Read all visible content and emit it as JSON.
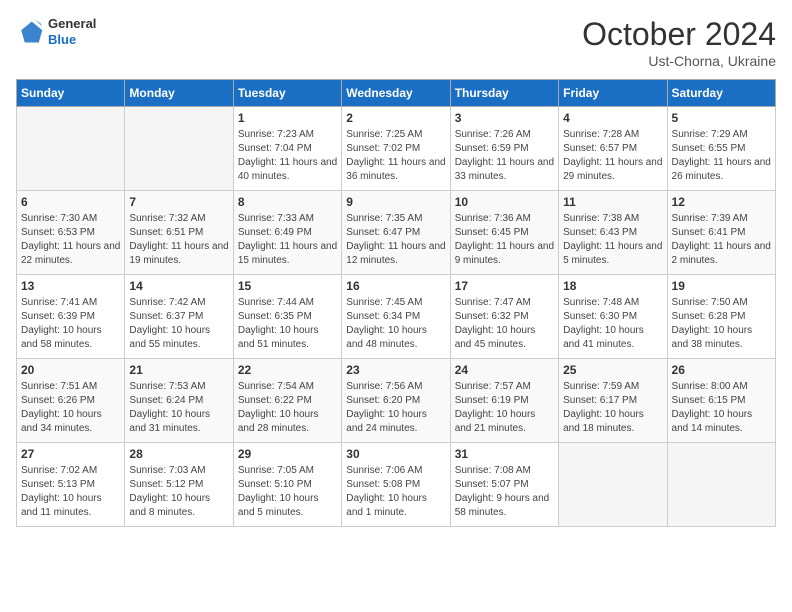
{
  "header": {
    "logo_general": "General",
    "logo_blue": "Blue",
    "month_title": "October 2024",
    "location": "Ust-Chorna, Ukraine"
  },
  "weekdays": [
    "Sunday",
    "Monday",
    "Tuesday",
    "Wednesday",
    "Thursday",
    "Friday",
    "Saturday"
  ],
  "weeks": [
    [
      {
        "day": "",
        "info": ""
      },
      {
        "day": "",
        "info": ""
      },
      {
        "day": "1",
        "info": "Sunrise: 7:23 AM\nSunset: 7:04 PM\nDaylight: 11 hours and 40 minutes."
      },
      {
        "day": "2",
        "info": "Sunrise: 7:25 AM\nSunset: 7:02 PM\nDaylight: 11 hours and 36 minutes."
      },
      {
        "day": "3",
        "info": "Sunrise: 7:26 AM\nSunset: 6:59 PM\nDaylight: 11 hours and 33 minutes."
      },
      {
        "day": "4",
        "info": "Sunrise: 7:28 AM\nSunset: 6:57 PM\nDaylight: 11 hours and 29 minutes."
      },
      {
        "day": "5",
        "info": "Sunrise: 7:29 AM\nSunset: 6:55 PM\nDaylight: 11 hours and 26 minutes."
      }
    ],
    [
      {
        "day": "6",
        "info": "Sunrise: 7:30 AM\nSunset: 6:53 PM\nDaylight: 11 hours and 22 minutes."
      },
      {
        "day": "7",
        "info": "Sunrise: 7:32 AM\nSunset: 6:51 PM\nDaylight: 11 hours and 19 minutes."
      },
      {
        "day": "8",
        "info": "Sunrise: 7:33 AM\nSunset: 6:49 PM\nDaylight: 11 hours and 15 minutes."
      },
      {
        "day": "9",
        "info": "Sunrise: 7:35 AM\nSunset: 6:47 PM\nDaylight: 11 hours and 12 minutes."
      },
      {
        "day": "10",
        "info": "Sunrise: 7:36 AM\nSunset: 6:45 PM\nDaylight: 11 hours and 9 minutes."
      },
      {
        "day": "11",
        "info": "Sunrise: 7:38 AM\nSunset: 6:43 PM\nDaylight: 11 hours and 5 minutes."
      },
      {
        "day": "12",
        "info": "Sunrise: 7:39 AM\nSunset: 6:41 PM\nDaylight: 11 hours and 2 minutes."
      }
    ],
    [
      {
        "day": "13",
        "info": "Sunrise: 7:41 AM\nSunset: 6:39 PM\nDaylight: 10 hours and 58 minutes."
      },
      {
        "day": "14",
        "info": "Sunrise: 7:42 AM\nSunset: 6:37 PM\nDaylight: 10 hours and 55 minutes."
      },
      {
        "day": "15",
        "info": "Sunrise: 7:44 AM\nSunset: 6:35 PM\nDaylight: 10 hours and 51 minutes."
      },
      {
        "day": "16",
        "info": "Sunrise: 7:45 AM\nSunset: 6:34 PM\nDaylight: 10 hours and 48 minutes."
      },
      {
        "day": "17",
        "info": "Sunrise: 7:47 AM\nSunset: 6:32 PM\nDaylight: 10 hours and 45 minutes."
      },
      {
        "day": "18",
        "info": "Sunrise: 7:48 AM\nSunset: 6:30 PM\nDaylight: 10 hours and 41 minutes."
      },
      {
        "day": "19",
        "info": "Sunrise: 7:50 AM\nSunset: 6:28 PM\nDaylight: 10 hours and 38 minutes."
      }
    ],
    [
      {
        "day": "20",
        "info": "Sunrise: 7:51 AM\nSunset: 6:26 PM\nDaylight: 10 hours and 34 minutes."
      },
      {
        "day": "21",
        "info": "Sunrise: 7:53 AM\nSunset: 6:24 PM\nDaylight: 10 hours and 31 minutes."
      },
      {
        "day": "22",
        "info": "Sunrise: 7:54 AM\nSunset: 6:22 PM\nDaylight: 10 hours and 28 minutes."
      },
      {
        "day": "23",
        "info": "Sunrise: 7:56 AM\nSunset: 6:20 PM\nDaylight: 10 hours and 24 minutes."
      },
      {
        "day": "24",
        "info": "Sunrise: 7:57 AM\nSunset: 6:19 PM\nDaylight: 10 hours and 21 minutes."
      },
      {
        "day": "25",
        "info": "Sunrise: 7:59 AM\nSunset: 6:17 PM\nDaylight: 10 hours and 18 minutes."
      },
      {
        "day": "26",
        "info": "Sunrise: 8:00 AM\nSunset: 6:15 PM\nDaylight: 10 hours and 14 minutes."
      }
    ],
    [
      {
        "day": "27",
        "info": "Sunrise: 7:02 AM\nSunset: 5:13 PM\nDaylight: 10 hours and 11 minutes."
      },
      {
        "day": "28",
        "info": "Sunrise: 7:03 AM\nSunset: 5:12 PM\nDaylight: 10 hours and 8 minutes."
      },
      {
        "day": "29",
        "info": "Sunrise: 7:05 AM\nSunset: 5:10 PM\nDaylight: 10 hours and 5 minutes."
      },
      {
        "day": "30",
        "info": "Sunrise: 7:06 AM\nSunset: 5:08 PM\nDaylight: 10 hours and 1 minute."
      },
      {
        "day": "31",
        "info": "Sunrise: 7:08 AM\nSunset: 5:07 PM\nDaylight: 9 hours and 58 minutes."
      },
      {
        "day": "",
        "info": ""
      },
      {
        "day": "",
        "info": ""
      }
    ]
  ]
}
